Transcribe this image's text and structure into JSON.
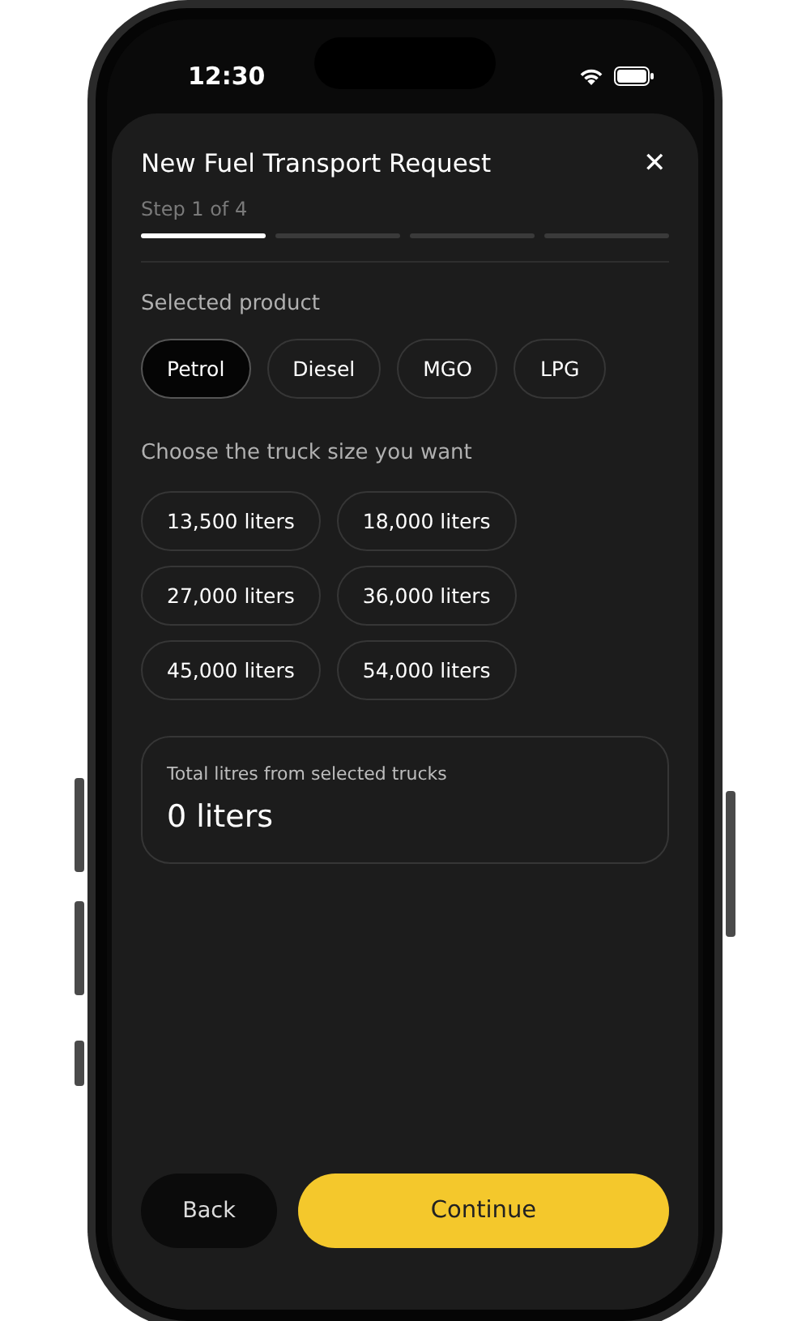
{
  "status_bar": {
    "time": "12:30"
  },
  "sheet": {
    "title": "New Fuel Transport Request",
    "close_glyph": "✕",
    "step": "Step 1 of 4",
    "progress": [
      {
        "active": true
      },
      {
        "active": false
      },
      {
        "active": false
      },
      {
        "active": false
      }
    ]
  },
  "product": {
    "label": "Selected product",
    "options": [
      {
        "label": "Petrol",
        "selected": true
      },
      {
        "label": "Diesel",
        "selected": false
      },
      {
        "label": "MGO",
        "selected": false
      },
      {
        "label": "LPG",
        "selected": false
      }
    ]
  },
  "trucks": {
    "label": "Choose the truck size you want",
    "rows": [
      [
        {
          "label": "13,500 liters",
          "selected": false
        },
        {
          "label": "18,000 liters",
          "selected": false
        }
      ],
      [
        {
          "label": "27,000 liters",
          "selected": false
        },
        {
          "label": "36,000 liters",
          "selected": false
        }
      ],
      [
        {
          "label": "45,000 liters",
          "selected": false
        },
        {
          "label": "54,000 liters",
          "selected": false
        }
      ]
    ]
  },
  "total": {
    "label": "Total litres from selected trucks",
    "value": "0 liters"
  },
  "buttons": {
    "back": "Back",
    "continue": "Continue"
  }
}
